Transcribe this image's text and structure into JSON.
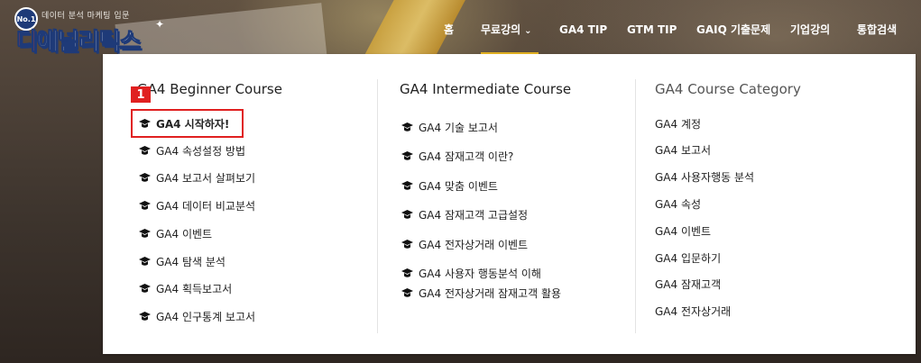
{
  "logo": {
    "tagline": "데이터 분석 마케팅 입문",
    "badge": "No.1",
    "name_first": "디",
    "name_rest": "애널리틱스"
  },
  "nav": {
    "items": [
      {
        "label": "홈"
      },
      {
        "label": "무료강의",
        "has_dropdown": true
      },
      {
        "label": "GA4 TIP"
      },
      {
        "label": "GTM TIP"
      },
      {
        "label": "GAIQ 기출문제"
      },
      {
        "label": "기업강의"
      },
      {
        "label": "통합검색"
      }
    ],
    "active": "무료강의"
  },
  "annotation": {
    "step_number": "1"
  },
  "dropdown": {
    "columns": [
      {
        "title": "GA4 Beginner Course",
        "items": [
          "GA4 시작하자!",
          "GA4 속성설정 방법",
          "GA4 보고서 살펴보기",
          "GA4 데이터 비교분석",
          "GA4 이벤트",
          "GA4 탐색 분석",
          "GA4 획득보고서",
          "GA4 인구통계 보고서"
        ]
      },
      {
        "title": "GA4 Intermediate Course",
        "items": [
          "GA4 기술 보고서",
          "GA4 잠재고객 이란?",
          "GA4 맞춤 이벤트",
          "GA4 잠재고객 고급설정",
          "GA4 전자상거래 이벤트",
          "GA4 사용자 행동분석 이해",
          "GA4 전자상거래 잠재고객 활용"
        ]
      },
      {
        "title": "GA4 Course Category",
        "items": [
          "GA4 계정",
          "GA4 보고서",
          "GA4 사용자행동 분석",
          "GA4 속성",
          "GA4 이벤트",
          "GA4 입문하기",
          "GA4 잠재고객",
          "GA4 전자상거래"
        ]
      }
    ]
  },
  "colors": {
    "accent": "#e6b422",
    "highlight": "#e02020",
    "logo_blue": "#1e3a78",
    "logo_red": "#e2442a"
  },
  "icons": {
    "course_item": "graduation-cap-icon",
    "dropdown": "chevron-down-icon"
  }
}
